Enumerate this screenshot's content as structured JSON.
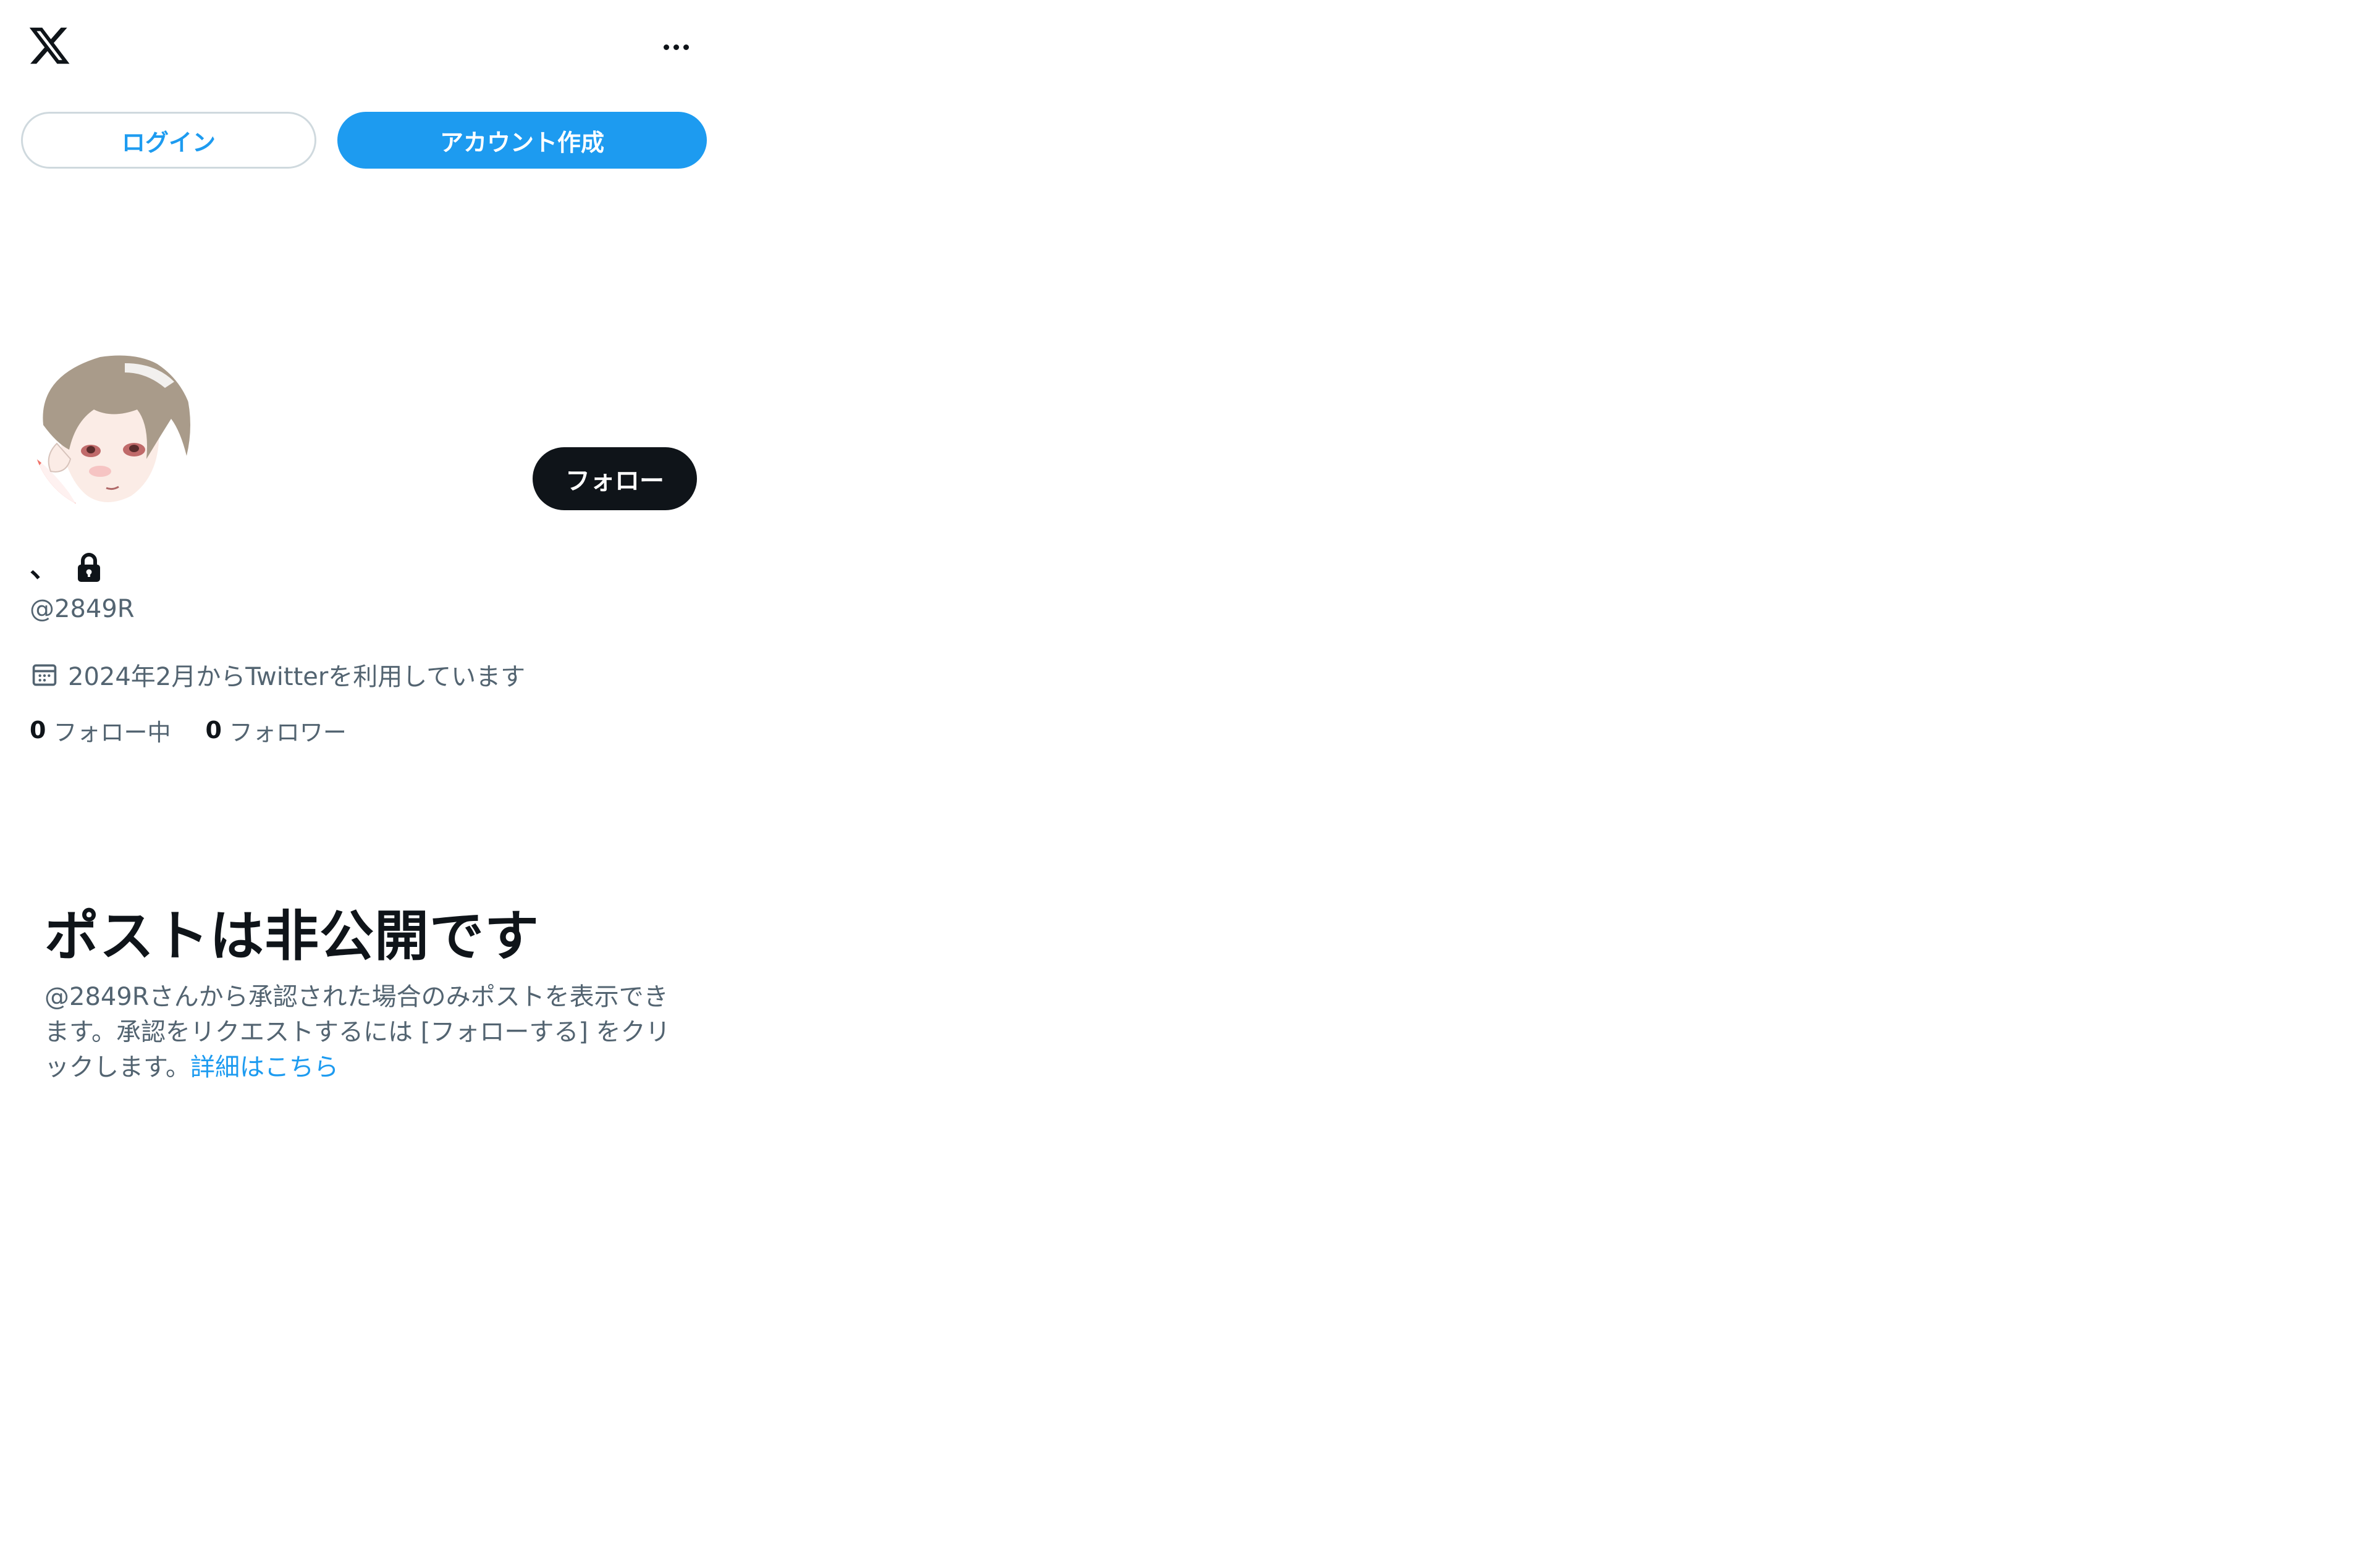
{
  "header": {
    "logo_icon": "x-logo-icon",
    "more_icon": "more-horizontal-icon"
  },
  "auth": {
    "login_label": "ログイン",
    "signup_label": "アカウント作成"
  },
  "profile": {
    "display_name": "、",
    "protected_icon": "lock-icon",
    "handle": "@2849R",
    "joined_icon": "calendar-icon",
    "joined": "2024年2月からTwitterを利用しています",
    "follow_label": "フォロー",
    "following_count": "0",
    "following_label": "フォロー中",
    "followers_count": "0",
    "followers_label": "フォロワー"
  },
  "private_notice": {
    "title": "ポストは非公開です",
    "description": "@2849Rさんから承認された場合のみポストを表示できます。承認をリクエストするには [フォローする] をクリックします。",
    "learn_more": "詳細はこちら"
  },
  "colors": {
    "accent": "#1d9bf0",
    "text_primary": "#0f1419",
    "text_secondary": "#536471",
    "border": "#cfd9de"
  }
}
